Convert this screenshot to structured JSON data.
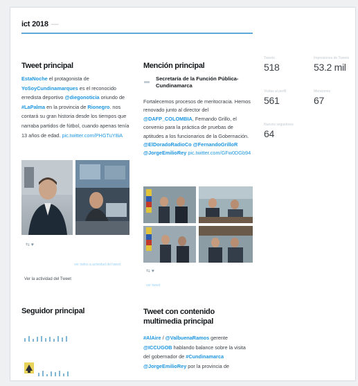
{
  "header": {
    "title": "ict 2018",
    "title_faint": "—",
    "subtitle": ""
  },
  "top_tweet": {
    "title": "Tweet principal",
    "faint": "",
    "parts": [
      {
        "t": "EstaNoche",
        "c": "m"
      },
      {
        "t": " el protagonista de "
      },
      {
        "t": "YoSoyCundinamarques",
        "c": "m"
      },
      {
        "t": " es el reconocido erredista deportivo "
      },
      {
        "t": "@diegonoticia",
        "c": "m"
      },
      {
        "t": " oriundo de "
      },
      {
        "t": "#LaPalma",
        "c": "m"
      },
      {
        "t": " en la provincia de "
      },
      {
        "t": "Rionegro",
        "c": "m"
      },
      {
        "t": ". nos contará su gran historia desde los tiempos que narraba partidos de fútbol, cuando apenas tenía 13 años de edad. "
      },
      {
        "t": "pic.twitter.com/PHGTuY8iA",
        "c": "l"
      }
    ],
    "icons": "⇆   ♥",
    "see_all": "ver todos a actividad del tweet",
    "activity_link": "Ver la actividad del Tweet"
  },
  "top_mention": {
    "title": "Mención principal",
    "faint": "",
    "author": "Secretaría de la Función Pública-Cundinamarca",
    "parts": [
      {
        "t": "Fortalecemos procesos de meritocracia. Hemos renovado junto al director del "
      },
      {
        "t": "@DAFP_COLOMBIA",
        "c": "m"
      },
      {
        "t": ", Fernando Grillo, el convenio para la práctica de pruebas de aptitudes a los funcionarios de la Gobernación. "
      },
      {
        "t": "@ElDoradoRadioCo",
        "c": "m"
      },
      {
        "t": " "
      },
      {
        "t": "@FernandoGrilloR",
        "c": "m"
      },
      {
        "t": " "
      },
      {
        "t": "@JorgeEmilioRey",
        "c": "m"
      },
      {
        "t": " "
      },
      {
        "t": "pic.twitter.com/GFw0DGb94",
        "c": "l"
      }
    ],
    "icons": "⇆   ♥",
    "see_all": "ver tweet"
  },
  "top_follower": {
    "title": "Seguidor principal",
    "faint": ""
  },
  "top_media": {
    "title": "Tweet con contenido multimedia principal",
    "faint": "",
    "parts": [
      {
        "t": "#AlAire",
        "c": "m"
      },
      {
        "t": " / "
      },
      {
        "t": "@ValbuenaRamos",
        "c": "m"
      },
      {
        "t": " gerente "
      },
      {
        "t": "@ICCUGOB",
        "c": "m"
      },
      {
        "t": " hablando balance sobre la visita del gobernador de "
      },
      {
        "t": "#Cundinamarca",
        "c": "m"
      },
      {
        "t": " "
      },
      {
        "t": "@JorgeEmilioRey",
        "c": "m"
      },
      {
        "t": " por la provincia de"
      }
    ]
  },
  "stats": [
    {
      "label": "Tweets",
      "value": "518"
    },
    {
      "label": "Impresiones de Tweets",
      "value": "53.2 mil"
    },
    {
      "label": "Visitas al perfil",
      "value": "561"
    },
    {
      "label": "Menciones",
      "value": "67"
    },
    {
      "label": "Nuevos seguidores",
      "value": "64"
    }
  ]
}
